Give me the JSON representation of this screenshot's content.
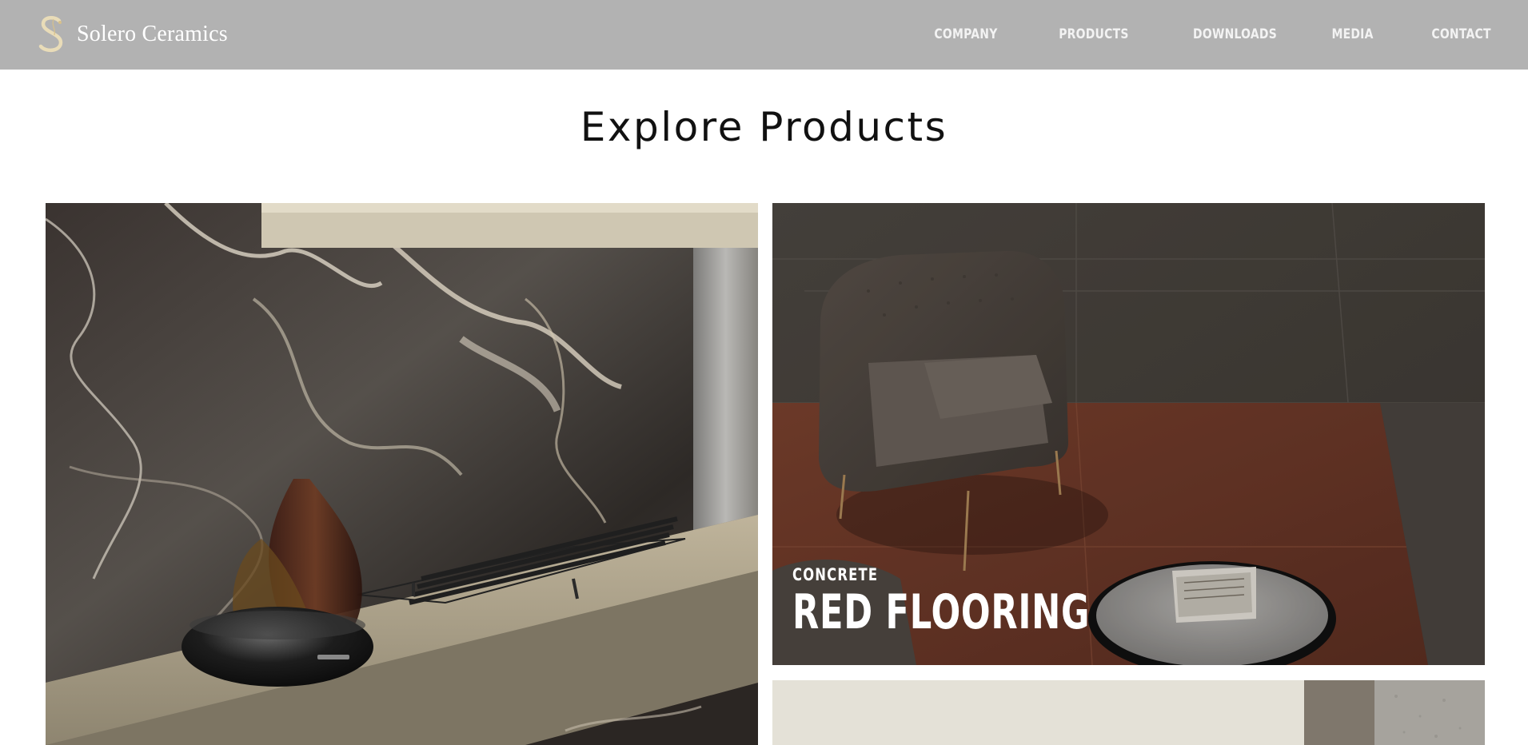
{
  "brand": {
    "name": "Solero Ceramics",
    "logo_icon": "s-monogram-logo",
    "accent_color": "#d8c08a"
  },
  "nav": {
    "items": [
      {
        "label": "COMPANY"
      },
      {
        "label": "PRODUCTS"
      },
      {
        "label": "DOWNLOADS"
      },
      {
        "label": "MEDIA"
      },
      {
        "label": "CONTACT"
      }
    ]
  },
  "page": {
    "title": "Explore Products"
  },
  "products": [
    {
      "category": "",
      "name": "",
      "image": "dark-marble-wall-interior"
    },
    {
      "category": "CONCRETE",
      "name": "RED FLOORING",
      "image": "armchair-on-red-concrete-floor"
    },
    {
      "category": "",
      "name": "",
      "image": "beige-wall-stone-samples"
    }
  ],
  "colors": {
    "header_bg": "#b2b2b2",
    "page_bg": "#ffffff",
    "title": "#111111"
  }
}
